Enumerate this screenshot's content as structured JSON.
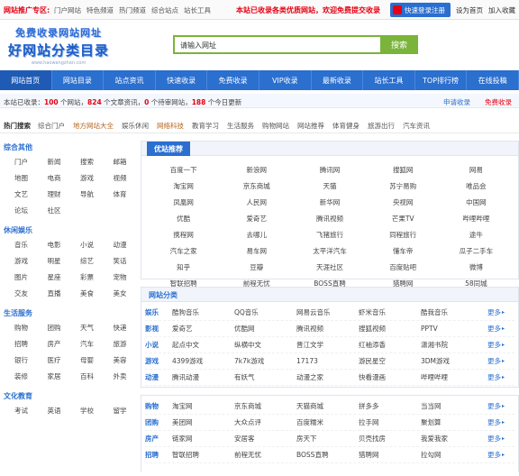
{
  "topbar": {
    "promo": "网站推广专区:",
    "links": [
      "门户网站",
      "特色频道",
      "热门频道",
      "综合站点",
      "站长工具"
    ],
    "notice": "本站已收录各类优质网站，欢迎免费提交收录",
    "login_label": "快速登录注册",
    "right_links": [
      "设为首页",
      "加入收藏"
    ]
  },
  "logo": {
    "line1": "免费收录网站网址",
    "line2": "好网站分类目录",
    "line3": "www.haowangzhan.com"
  },
  "search": {
    "placeholder": "请输入网址",
    "button": "搜索"
  },
  "nav": [
    "网站首页",
    "网站目录",
    "站点资讯",
    "快速收录",
    "免费收录",
    "VIP收录",
    "最新收录",
    "站长工具",
    "TOP排行榜",
    "在线投稿"
  ],
  "stats": {
    "prefix": "本站已收录：",
    "sites_count": "100",
    "sites_label": " 个网站，",
    "articles_count": "824",
    "articles_label": " 个文章资讯，",
    "pending_count": "0",
    "pending_label": " 个待审网站，",
    "today_count": "188",
    "today_label": " 个今日更新",
    "right1": "申请收录",
    "right2": "免费收录"
  },
  "hotcats": {
    "label": "热门搜索",
    "items": [
      {
        "t": "综合门户",
        "hl": false
      },
      {
        "t": "地方网站大全",
        "hl": true
      },
      {
        "t": "娱乐休闲",
        "hl": false
      },
      {
        "t": "网络科技",
        "hl": true
      },
      {
        "t": "教育学习",
        "hl": false
      },
      {
        "t": "生活服务",
        "hl": false
      },
      {
        "t": "购物网站",
        "hl": false
      },
      {
        "t": "网站推荐",
        "hl": false
      },
      {
        "t": "体育健身",
        "hl": false
      },
      {
        "t": "旅游出行",
        "hl": false
      },
      {
        "t": "汽车资讯",
        "hl": false
      }
    ]
  },
  "sidebar": [
    {
      "title": "综合其他",
      "items": [
        "门户",
        "新闻",
        "搜索",
        "邮箱",
        "地图",
        "电商",
        "游戏",
        "视频",
        "文艺",
        "理财",
        "导航",
        "体育",
        "论坛",
        "社区"
      ]
    },
    {
      "title": "休闲娱乐",
      "items": [
        "音乐",
        "电影",
        "小说",
        "动漫",
        "游戏",
        "明星",
        "综艺",
        "笑话",
        "图片",
        "星座",
        "彩票",
        "宠物",
        "交友",
        "直播",
        "美食",
        "美女"
      ]
    },
    {
      "title": "生活服务",
      "items": [
        "购物",
        "团购",
        "天气",
        "快递",
        "招聘",
        "房产",
        "汽车",
        "旅游",
        "银行",
        "医疗",
        "母婴",
        "美容",
        "装修",
        "家居",
        "百科",
        "外卖"
      ]
    },
    {
      "title": "文化教育",
      "items": [
        "考试",
        "英语",
        "学校",
        "留学"
      ]
    }
  ],
  "main": {
    "panel1_title": "优站推荐",
    "panel1_items": [
      "百度一下",
      "新浪网",
      "腾讯网",
      "搜狐网",
      "网易",
      "淘宝网",
      "京东商城",
      "天猫",
      "苏宁易购",
      "唯品会",
      "凤凰网",
      "人民网",
      "新华网",
      "央视网",
      "中国网",
      "优酷",
      "爱奇艺",
      "腾讯视频",
      "芒果TV",
      "哔哩哔哩",
      "携程网",
      "去哪儿",
      "飞猪旅行",
      "同程旅行",
      "途牛",
      "汽车之家",
      "易车网",
      "太平洋汽车",
      "懂车帝",
      "瓜子二手车",
      "知乎",
      "豆瓣",
      "天涯社区",
      "百度贴吧",
      "微博",
      "智联招聘",
      "前程无忧",
      "BOSS直聘",
      "猎聘网",
      "58同城"
    ],
    "panel2_title": "网站分类",
    "panel2_rows": [
      {
        "cat": "娱乐",
        "cells": [
          "酷狗音乐",
          "QQ音乐",
          "网易云音乐",
          "虾米音乐",
          "酷我音乐"
        ],
        "more": "更多"
      },
      {
        "cat": "影视",
        "cells": [
          "爱奇艺",
          "优酷网",
          "腾讯视频",
          "搜狐视频",
          "PPTV"
        ],
        "more": "更多"
      },
      {
        "cat": "小说",
        "cells": [
          "起点中文",
          "纵横中文",
          "晋江文学",
          "红袖添香",
          "潇湘书院"
        ],
        "more": "更多"
      },
      {
        "cat": "游戏",
        "cells": [
          "4399游戏",
          "7k7k游戏",
          "17173",
          "游民星空",
          "3DM游戏"
        ],
        "more": "更多"
      },
      {
        "cat": "动漫",
        "cells": [
          "腾讯动漫",
          "有妖气",
          "动漫之家",
          "快看漫画",
          "哔哩哔哩"
        ],
        "more": "更多"
      }
    ],
    "panel3_rows": [
      {
        "cat": "购物",
        "cells": [
          "淘宝网",
          "京东商城",
          "天猫商城",
          "拼多多",
          "当当网"
        ],
        "more": "更多"
      },
      {
        "cat": "团购",
        "cells": [
          "美团网",
          "大众点评",
          "百度糯米",
          "拉手网",
          "聚划算"
        ],
        "more": "更多"
      },
      {
        "cat": "房产",
        "cells": [
          "链家网",
          "安居客",
          "房天下",
          "贝壳找房",
          "我爱我家"
        ],
        "more": "更多"
      },
      {
        "cat": "招聘",
        "cells": [
          "智联招聘",
          "前程无忧",
          "BOSS直聘",
          "猎聘网",
          "拉勾网"
        ],
        "more": "更多"
      }
    ]
  },
  "colors": {
    "brand_blue": "#2b6fcf",
    "search_green": "#7ab43a",
    "alert_red": "#e60012"
  }
}
